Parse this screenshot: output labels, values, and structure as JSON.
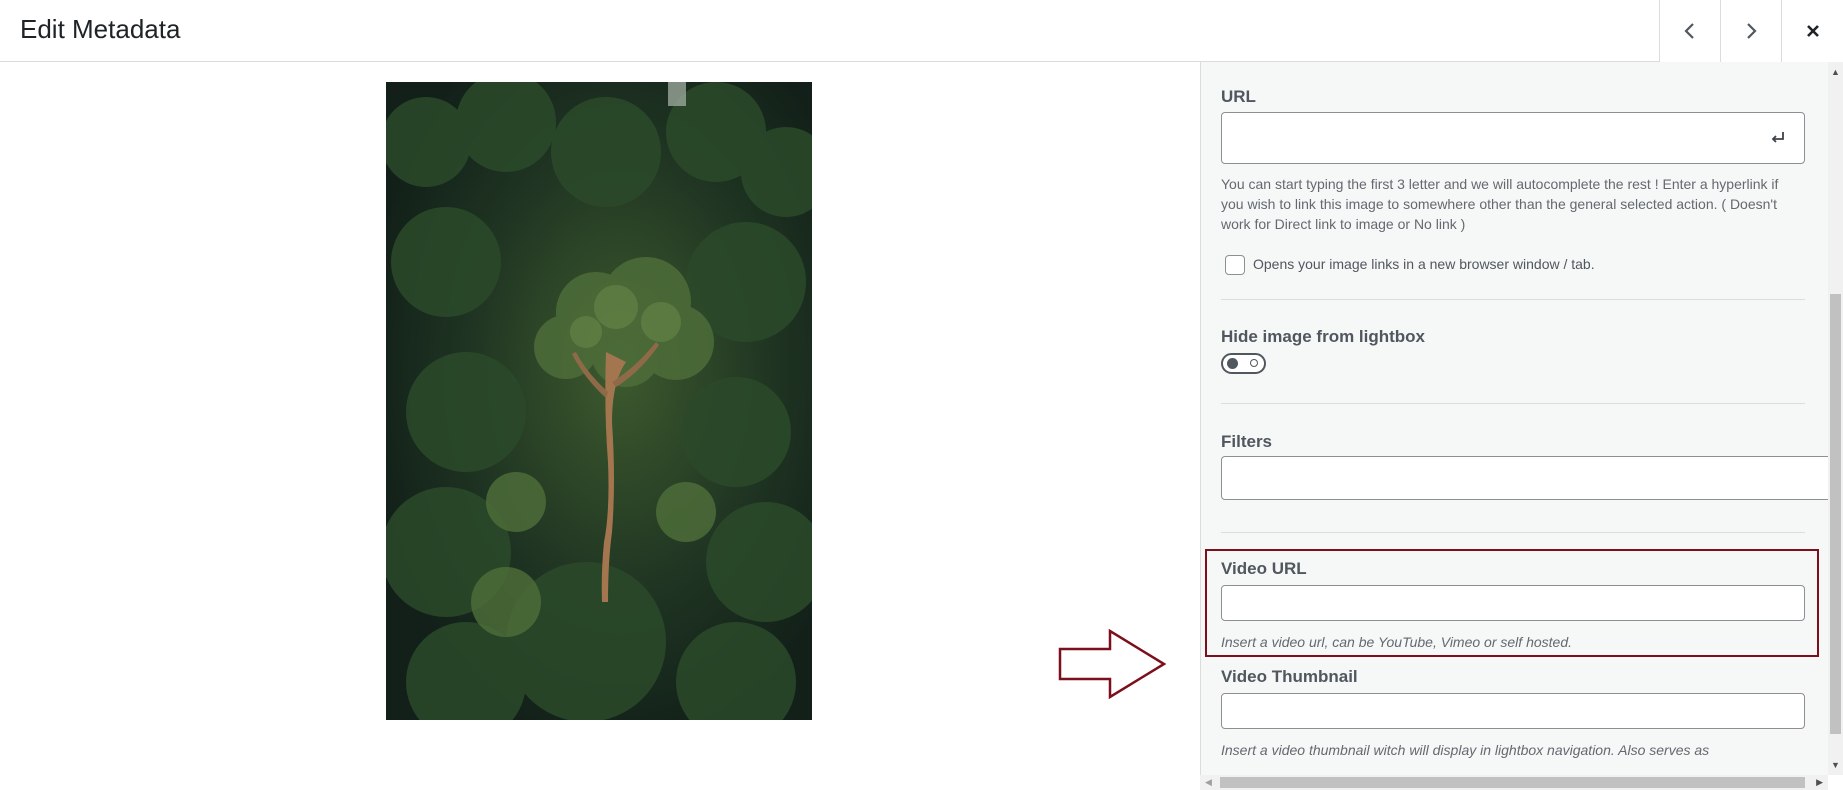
{
  "header": {
    "title": "Edit Metadata",
    "prev_icon": "chevron-left-icon",
    "next_icon": "chevron-right-icon",
    "close_icon": "close-icon"
  },
  "preview": {
    "image_icon": "forest-tree-photo"
  },
  "panel": {
    "url": {
      "label": "URL",
      "value": "",
      "enter_icon": "enter-return-icon",
      "help": "You can start typing the first 3 letter and we will autocomplete the rest ! Enter a hyperlink if you wish to link this image to somewhere other than the general selected action. ( Doesn't work for Direct link to image or No link )"
    },
    "new_window": {
      "label": "Opens your image links in a new browser window / tab.",
      "checked": false
    },
    "hide_lightbox": {
      "label": "Hide image from lightbox",
      "enabled": false
    },
    "filters": {
      "label": "Filters",
      "value": ""
    },
    "video_url": {
      "label": "Video URL",
      "value": "",
      "help": "Insert a video url, can be YouTube, Vimeo or self hosted."
    },
    "video_thumbnail": {
      "label": "Video Thumbnail",
      "value": "",
      "help": "Insert a video thumbnail witch will display in lightbox navigation. Also serves as"
    }
  },
  "colors": {
    "highlight": "#7b0f1b",
    "panel_bg": "#f6f7f7"
  }
}
